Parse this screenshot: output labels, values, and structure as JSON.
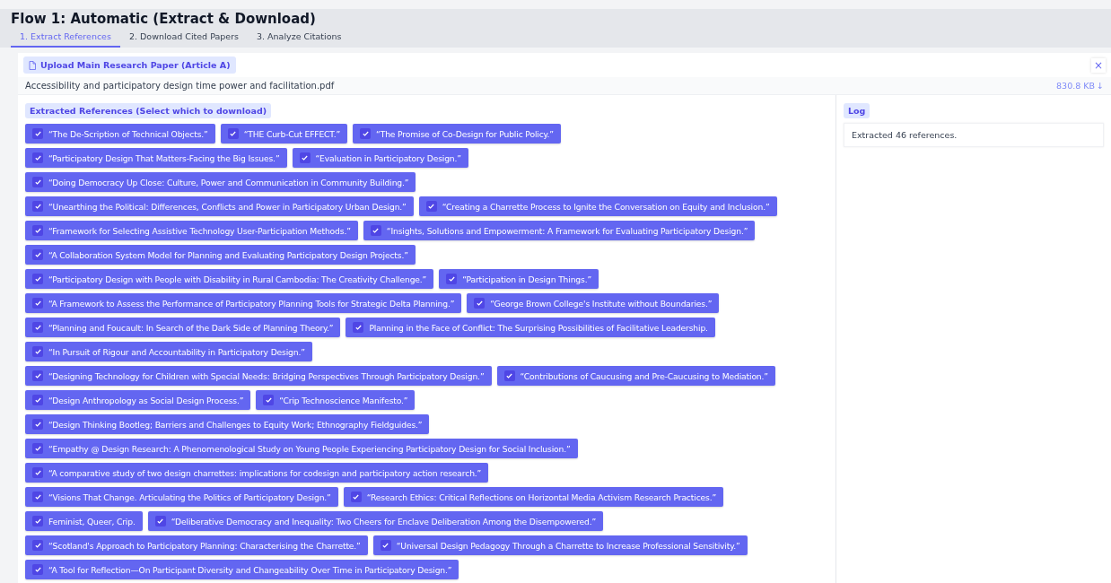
{
  "title": "Flow 1: Automatic (Extract & Download)",
  "tabs": [
    {
      "label": "1. Extract References",
      "selected": true
    },
    {
      "label": "2. Download Cited Papers",
      "selected": false
    },
    {
      "label": "3. Analyze Citations",
      "selected": false
    }
  ],
  "upload": {
    "label": "Upload Main Research Paper (Article A)",
    "close": "×",
    "file_name": "Accessibility and participatory design time power and facilitation.pdf",
    "file_size": "830.8 KB",
    "download": "↓"
  },
  "references_heading": "Extracted References (Select which to download)",
  "reference_rows": [
    [
      {
        "title": "“The De-Scription of Technical Objects.”",
        "checked": true
      },
      {
        "title": "“THE Curb-Cut EFFECT.”",
        "checked": true
      },
      {
        "title": "“The Promise of Co-Design for Public Policy.”",
        "checked": true
      }
    ],
    [
      {
        "title": "“Participatory Design That Matters-Facing the Big Issues.”",
        "checked": true
      },
      {
        "title": "“Evaluation in Participatory Design.”",
        "checked": true
      }
    ],
    [
      {
        "title": "“Doing Democracy Up Close: Culture, Power and Communication in Community Building.”",
        "checked": true
      }
    ],
    [
      {
        "title": "“Unearthing the Political: Differences, Conflicts and Power in Participatory Urban Design.”",
        "checked": true
      },
      {
        "title": "“Creating a Charrette Process to Ignite the Conversation on Equity and Inclusion.”",
        "checked": true
      }
    ],
    [
      {
        "title": "“Framework for Selecting Assistive Technology User-Participation Methods.”",
        "checked": true
      },
      {
        "title": "“Insights, Solutions and Empowerment: A Framework for Evaluating Participatory Design.”",
        "checked": true
      }
    ],
    [
      {
        "title": "“A Collaboration System Model for Planning and Evaluating Participatory Design Projects.”",
        "checked": true
      }
    ],
    [
      {
        "title": "“Participatory Design with People with Disability in Rural Cambodia: The Creativity Challenge.”",
        "checked": true
      },
      {
        "title": "“Participation in Design Things.”",
        "checked": true
      }
    ],
    [
      {
        "title": "“A Framework to Assess the Performance of Participatory Planning Tools for Strategic Delta Planning.”",
        "checked": true
      },
      {
        "title": "“George Brown College's Institute without Boundaries.”",
        "checked": true
      }
    ],
    [
      {
        "title": "“Planning and Foucault: In Search of the Dark Side of Planning Theory.”",
        "checked": true
      },
      {
        "title": "Planning in the Face of Conflict: The Surprising Possibilities of Facilitative Leadership.",
        "checked": true
      }
    ],
    [
      {
        "title": "“In Pursuit of Rigour and Accountability in Participatory Design.”",
        "checked": true
      }
    ],
    [
      {
        "title": "“Designing Technology for Children with Special Needs: Bridging Perspectives Through Participatory Design.”",
        "checked": true
      },
      {
        "title": "“Contributions of Caucusing and Pre-Caucusing to Mediation.”",
        "checked": true
      }
    ],
    [
      {
        "title": "“Design Anthropology as Social Design Process.”",
        "checked": true
      },
      {
        "title": "“Crip Technoscience Manifesto.”",
        "checked": true
      }
    ],
    [
      {
        "title": "“Design Thinking Bootleg; Barriers and Challenges to Equity Work; Ethnography Fieldguides.”",
        "checked": true
      }
    ],
    [
      {
        "title": "“Empathy @ Design Research: A Phenomenological Study on Young People Experiencing Participatory Design for Social Inclusion.”",
        "checked": true
      }
    ],
    [
      {
        "title": "“A comparative study of two design charrettes: implications for codesign and participatory action research.”",
        "checked": true
      }
    ],
    [
      {
        "title": "“Visions That Change. Articulating the Politics of Participatory Design.”",
        "checked": true
      },
      {
        "title": "“Research Ethics: Critical Reflections on Horizontal Media Activism Research Practices.”",
        "checked": true
      }
    ],
    [
      {
        "title": "Feminist, Queer, Crip.",
        "checked": true
      },
      {
        "title": "“Deliberative Democracy and Inequality: Two Cheers for Enclave Deliberation Among the Disempowered.”",
        "checked": true
      }
    ],
    [
      {
        "title": "“Scotland's Approach to Participatory Planning: Characterising the Charrette.”",
        "checked": true
      },
      {
        "title": "“Universal Design Pedagogy Through a Charrette to Increase Professional Sensitivity.”",
        "checked": true
      }
    ],
    [
      {
        "title": "“A Tool for Reflection—On Participant Diversity and Changeability Over Time in Participatory Design.”",
        "checked": true
      }
    ]
  ],
  "log": {
    "heading": "Log",
    "entries": [
      "Extracted 46 references."
    ]
  }
}
